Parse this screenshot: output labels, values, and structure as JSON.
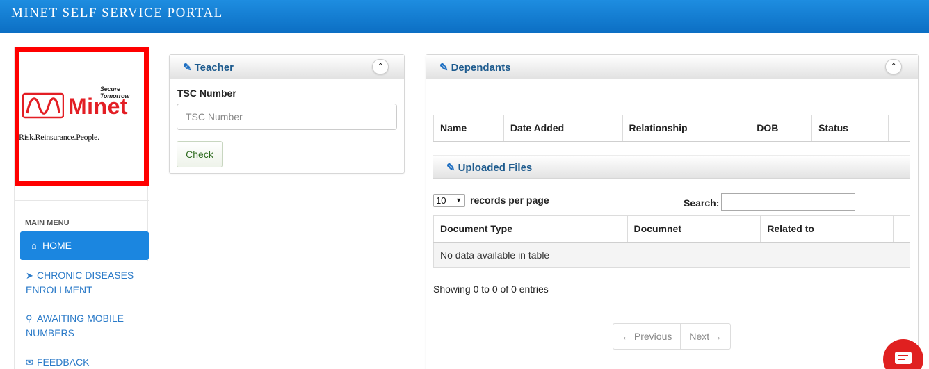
{
  "header": {
    "title": "MINET SELF SERVICE PORTAL"
  },
  "logo": {
    "tagline": "Secure Tomorrow",
    "name": "Minet",
    "subline": "Risk.Reinsurance.People."
  },
  "sidebar": {
    "menu_heading": "MAIN MENU",
    "items": [
      {
        "label": "HOME",
        "icon": "home-icon"
      },
      {
        "label": "CHRONIC DISEASES ENROLLMENT",
        "icon": "paper-plane-icon"
      },
      {
        "label": "AWAITING MOBILE NUMBERS",
        "icon": "search-plus-icon"
      },
      {
        "label": "FEEDBACK",
        "icon": "envelope-icon"
      }
    ]
  },
  "teacher_panel": {
    "title": "Teacher",
    "field_label": "TSC Number",
    "field_placeholder": "TSC Number",
    "field_value": "",
    "button_label": "Check"
  },
  "dependants_panel": {
    "title": "Dependants",
    "columns": [
      "Name",
      "Date Added",
      "Relationship",
      "DOB",
      "Status"
    ]
  },
  "uploaded_files": {
    "title": "Uploaded Files",
    "page_size": "10",
    "page_size_suffix": "records per page",
    "search_label": "Search:",
    "columns": [
      "Document Type",
      "Documnet",
      "Related to"
    ],
    "empty_message": "No data available in table",
    "info": "Showing 0 to 0 of 0 entries",
    "prev_label": "← Previous",
    "next_label": "Next →"
  },
  "colors": {
    "header": "#1b86e0",
    "logo_red": "#e31e24",
    "accent": "#1e6fc2"
  }
}
